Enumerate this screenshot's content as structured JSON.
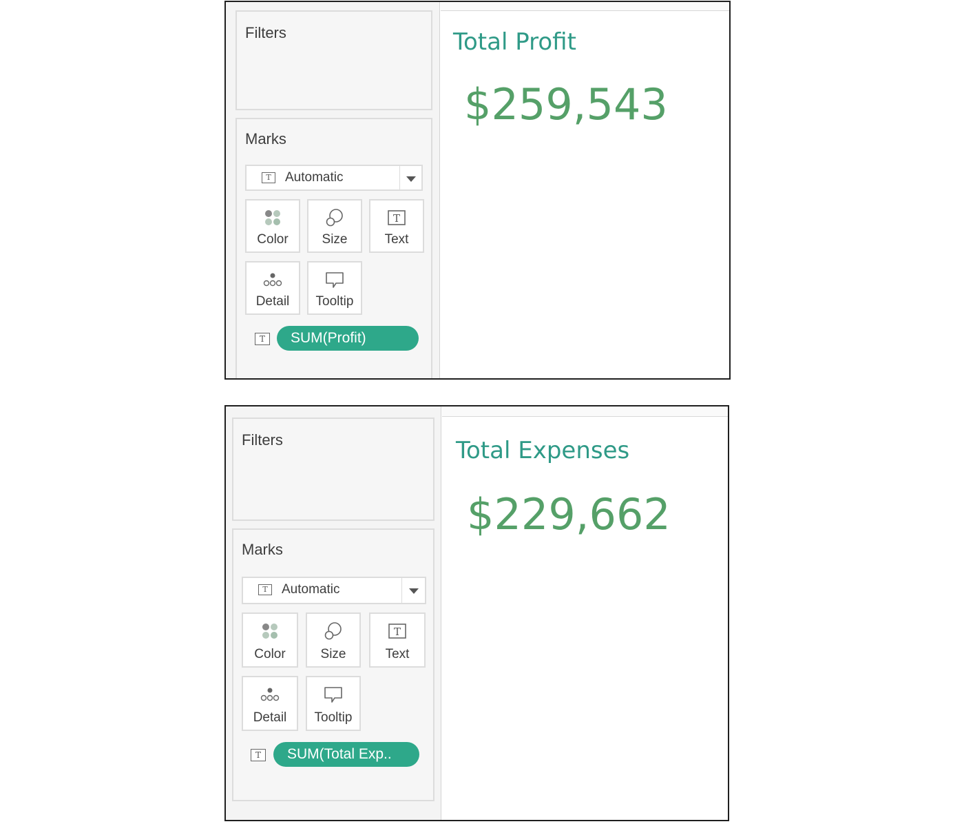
{
  "panels": [
    {
      "filters_title": "Filters",
      "marks_title": "Marks",
      "mark_type": "Automatic",
      "buttons": {
        "color": "Color",
        "size": "Size",
        "text": "Text",
        "detail": "Detail",
        "tooltip": "Tooltip"
      },
      "text_icon_glyph": "T",
      "pill_label": "SUM(Profit)",
      "view_title": "Total Profit",
      "view_value": "$259,543"
    },
    {
      "filters_title": "Filters",
      "marks_title": "Marks",
      "mark_type": "Automatic",
      "buttons": {
        "color": "Color",
        "size": "Size",
        "text": "Text",
        "detail": "Detail",
        "tooltip": "Tooltip"
      },
      "text_icon_glyph": "T",
      "pill_label": "SUM(Total Exp..",
      "view_title": "Total Expenses",
      "view_value": "$229,662"
    }
  ],
  "colors": {
    "pill": "#2ea88a",
    "title": "#2f9a87",
    "value": "#55a068"
  },
  "icons": [
    "text-type-icon",
    "color-dots-icon",
    "size-circles-icon",
    "text-box-icon",
    "detail-dots-icon",
    "tooltip-bubble-icon",
    "chevron-down-icon"
  ]
}
